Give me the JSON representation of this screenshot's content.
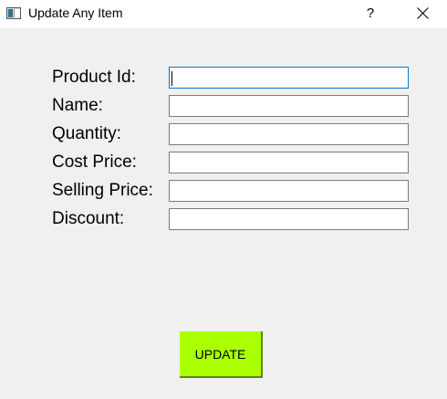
{
  "window": {
    "title": "Update Any Item",
    "help_label": "?",
    "close_icon": "close-icon",
    "app_icon": "window-icon"
  },
  "form": {
    "fields": [
      {
        "label": "Product Id:",
        "value": "",
        "focused": true
      },
      {
        "label": "Name:",
        "value": ""
      },
      {
        "label": "Quantity:",
        "value": ""
      },
      {
        "label": "Cost Price:",
        "value": ""
      },
      {
        "label": "Selling Price:",
        "value": ""
      },
      {
        "label": "Discount:",
        "value": ""
      }
    ],
    "submit_label": "UPDATE"
  },
  "colors": {
    "button_background": "#aaff00",
    "focus_border": "#0078d7",
    "window_background": "#f0f0f0"
  }
}
